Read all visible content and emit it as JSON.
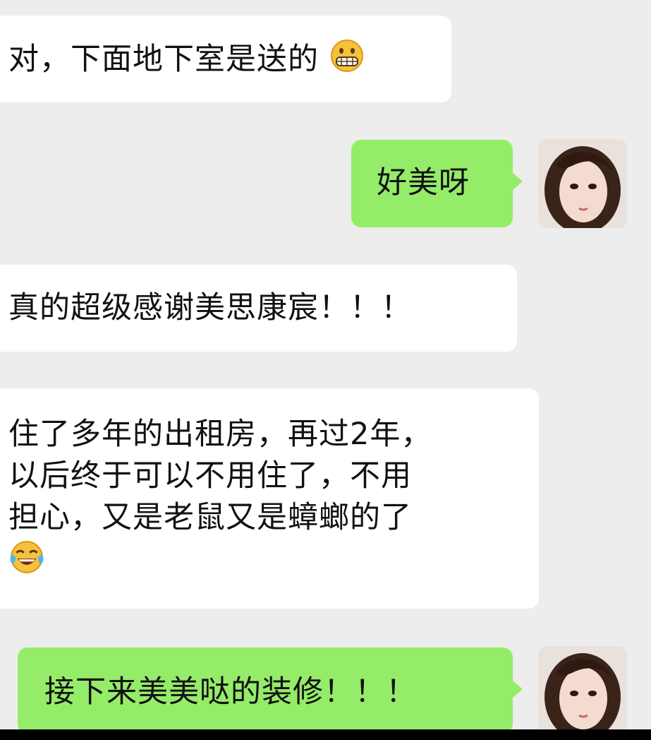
{
  "messages": [
    {
      "side": "incoming",
      "text": "对，下面地下室是送的",
      "emoji": "grimace-emoji"
    },
    {
      "side": "outgoing",
      "text": "好美呀",
      "avatar": "user-avatar"
    },
    {
      "side": "incoming",
      "text": "真的超级感谢美思康宸！！！"
    },
    {
      "side": "incoming",
      "lines": [
        "住了多年的出租房，再过2年，",
        "以后终于可以不用住了，不用",
        "担心，又是老鼠又是蟑螂的了"
      ],
      "emoji": "tears-of-joy-emoji"
    },
    {
      "side": "outgoing",
      "text": "接下来美美哒的装修！！！",
      "avatar": "user-avatar"
    }
  ],
  "colors": {
    "background": "#ededed",
    "incoming_bubble": "#ffffff",
    "outgoing_bubble": "#95ec69",
    "text": "#111111"
  }
}
